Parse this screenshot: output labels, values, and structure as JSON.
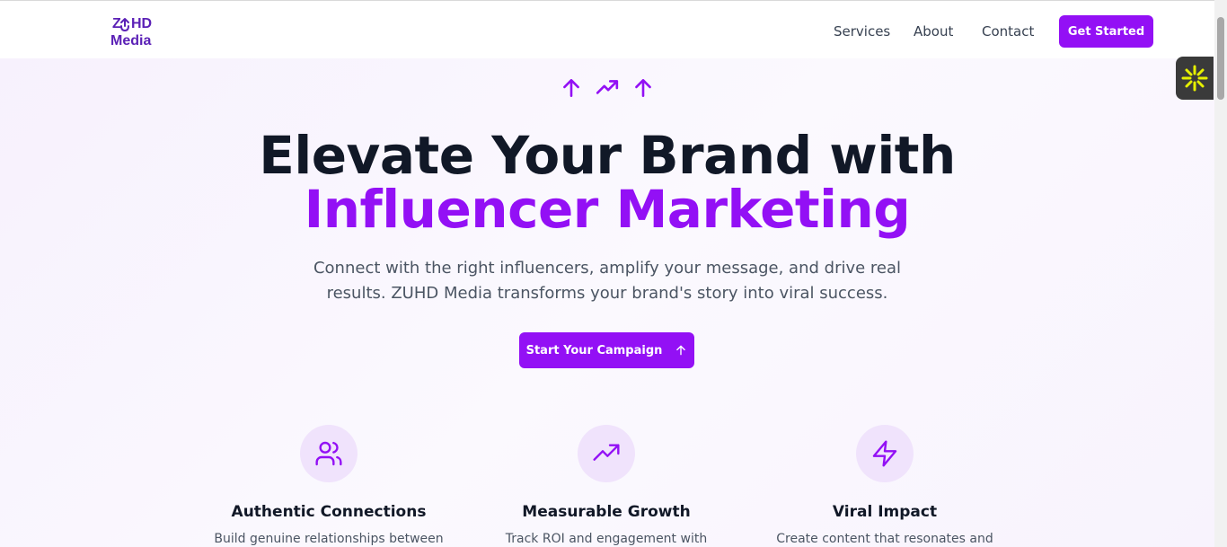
{
  "nav": {
    "logo_line1": "ZUHD",
    "logo_line1_z": "Z",
    "logo_line1_hd": "HD",
    "logo_line2": "Media",
    "links": [
      "Services",
      "About",
      "Contact"
    ],
    "cta_label": "Get Started"
  },
  "hero": {
    "icons": [
      "arrow-up-icon",
      "trending-up-icon",
      "arrow-up-icon"
    ],
    "headline_line1": "Elevate Your Brand with",
    "headline_line2": "Influencer Marketing",
    "subtitle": "Connect with the right influencers, amplify your message, and drive real results. ZUHD Media transforms your brand's story into viral success.",
    "cta_label": "Start Your Campaign",
    "cta_icon": "arrow-up-icon"
  },
  "features": [
    {
      "icon": "users-icon",
      "title": "Authentic Connections",
      "description": "Build genuine relationships between"
    },
    {
      "icon": "trending-up-icon",
      "title": "Measurable Growth",
      "description": "Track ROI and engagement with"
    },
    {
      "icon": "zap-icon",
      "title": "Viral Impact",
      "description": "Create content that resonates and"
    }
  ],
  "colors": {
    "accent": "#9310f5",
    "logo": "#5b21b6",
    "heading": "#111827",
    "body_text": "#4b5563",
    "icon_circle": "#f0e3fc",
    "widget_bg": "#3a3a3a",
    "widget_icon": "#e6f000"
  },
  "side_widget": {
    "icon": "sparkle-icon"
  }
}
